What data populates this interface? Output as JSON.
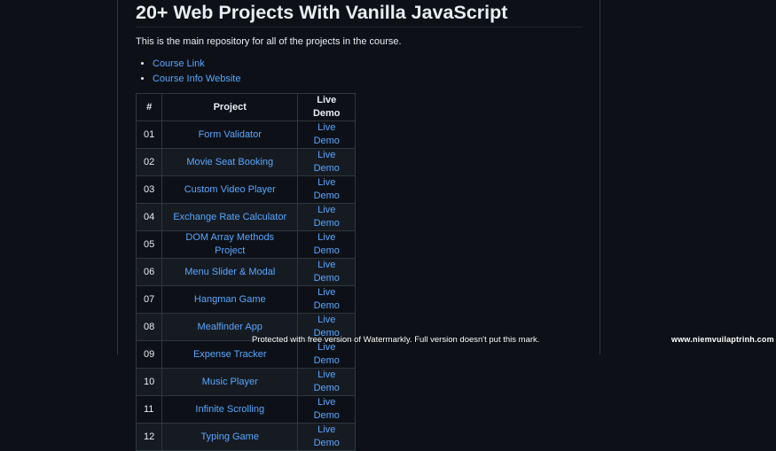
{
  "readme": {
    "title": "20+ Web Projects With Vanilla JavaScript",
    "intro": "This is the main repository for all of the projects in the course.",
    "links": [
      {
        "label": "Course Link"
      },
      {
        "label": "Course Info Website"
      }
    ],
    "table": {
      "headers": [
        "#",
        "Project",
        "Live Demo"
      ],
      "rows": [
        {
          "num": "01",
          "project": "Form Validator",
          "demo": "Live Demo"
        },
        {
          "num": "02",
          "project": "Movie Seat Booking",
          "demo": "Live Demo"
        },
        {
          "num": "03",
          "project": "Custom Video Player",
          "demo": "Live Demo"
        },
        {
          "num": "04",
          "project": "Exchange Rate Calculator",
          "demo": "Live Demo"
        },
        {
          "num": "05",
          "project": "DOM Array Methods Project",
          "demo": "Live Demo"
        },
        {
          "num": "06",
          "project": "Menu Slider & Modal",
          "demo": "Live Demo"
        },
        {
          "num": "07",
          "project": "Hangman Game",
          "demo": "Live Demo"
        },
        {
          "num": "08",
          "project": "Mealfinder App",
          "demo": "Live Demo"
        },
        {
          "num": "09",
          "project": "Expense Tracker",
          "demo": "Live Demo"
        },
        {
          "num": "10",
          "project": "Music Player",
          "demo": "Live Demo"
        },
        {
          "num": "11",
          "project": "Infinite Scrolling",
          "demo": "Live Demo"
        },
        {
          "num": "12",
          "project": "Typing Game",
          "demo": "Live Demo"
        }
      ]
    }
  },
  "overlay": {
    "watermark": "Protected with free version of Watermarkly. Full version doesn't put this mark.",
    "site": "www.niemvuilaptrinh.com"
  },
  "colors": {
    "background": "#0d1117",
    "link": "#58a6ff",
    "text": "#e6edf3",
    "border": "#30363d",
    "row_alt": "#161b22"
  }
}
